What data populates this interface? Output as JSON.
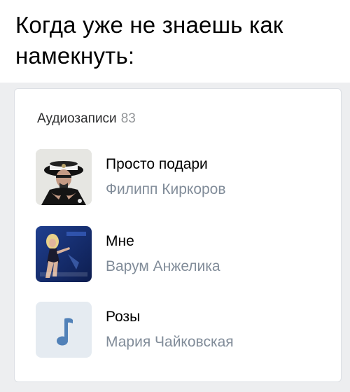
{
  "caption": "Когда уже не знаешь как намекнуть:",
  "audio_section": {
    "title": "Аудиозаписи",
    "count": "83"
  },
  "tracks": [
    {
      "title": "Просто подари",
      "artist": "Филипп Киркоров",
      "cover": "album-cover-photo"
    },
    {
      "title": "Мне",
      "artist": "Варум Анжелика",
      "cover": "album-cover-photo"
    },
    {
      "title": "Розы",
      "artist": "Мария Чайковская",
      "cover": "music-note-icon"
    }
  ],
  "colors": {
    "placeholder_bg": "#e5ebf1",
    "note_icon": "#5181b8",
    "artist_text": "#818c99",
    "count_text": "#939699"
  }
}
